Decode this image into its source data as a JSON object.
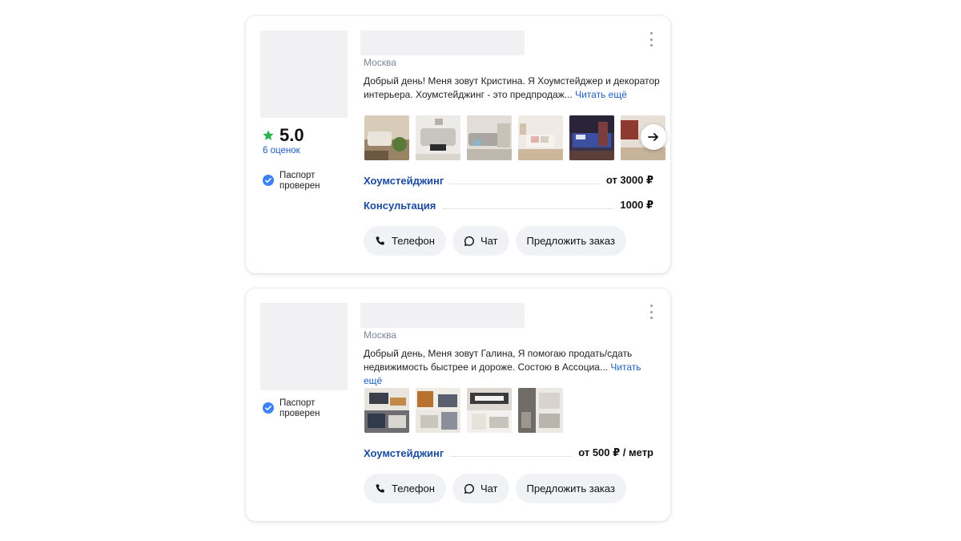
{
  "colors": {
    "link": "#1f5fbf",
    "service": "#1a4ba0",
    "star": "#2eb24a",
    "verified": "#3b82f6",
    "button_bg": "#f1f2f6"
  },
  "cards": [
    {
      "city": "Москва",
      "description": "Добрый день! Меня зовут Кристина. Я Хоумстейджер и декоратор интерьера. Хоумстейджинг - это предпродаж...",
      "read_more": "Читать ещё",
      "rating": {
        "score": "5.0",
        "reviews": "6 оценок",
        "icon": "star-icon"
      },
      "verified": "Паспорт проверен",
      "photos_next_icon": "arrow-right-icon",
      "services": [
        {
          "name": "Хоумстейджинг",
          "price": "от 3000 ₽"
        },
        {
          "name": "Консультация",
          "price": "1000 ₽"
        }
      ],
      "actions": {
        "phone": "Телефон",
        "chat": "Чат",
        "offer": "Предложить заказ"
      }
    },
    {
      "city": "Москва",
      "description": "Добрый день, Меня зовут Галина, Я помогаю продать/сдать недвижимость быстрее и дороже. Состою в Ассоциа...",
      "read_more": "Читать ещё",
      "verified": "Паспорт проверен",
      "services": [
        {
          "name": "Хоумстейджинг",
          "price": "от 500 ₽ / метр"
        }
      ],
      "actions": {
        "phone": "Телефон",
        "chat": "Чат",
        "offer": "Предложить заказ"
      }
    }
  ]
}
